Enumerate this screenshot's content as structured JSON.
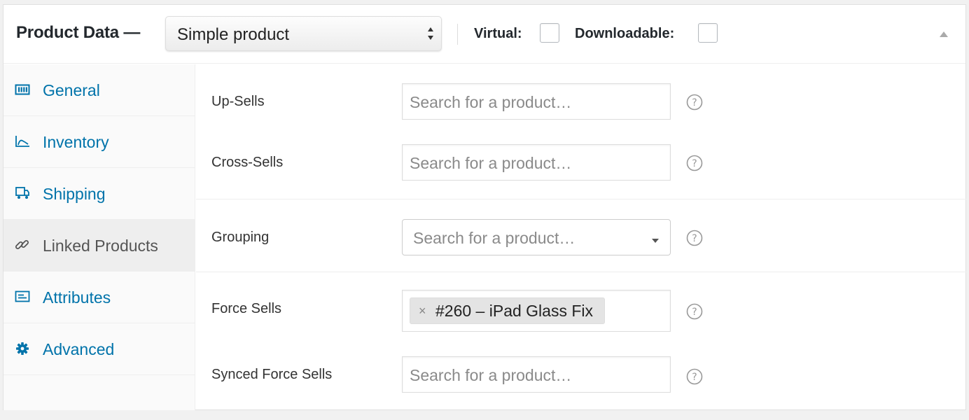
{
  "header": {
    "title": "Product Data —",
    "product_type": "Simple product",
    "virtual_label": "Virtual:",
    "downloadable_label": "Downloadable:",
    "virtual_checked": false,
    "downloadable_checked": false
  },
  "colors": {
    "link": "#0073aa",
    "active_tab_bg": "#eeeeee",
    "sidebar_bg": "#fafafa"
  },
  "tabs": [
    {
      "label": "General",
      "icon": "general-icon",
      "active": false
    },
    {
      "label": "Inventory",
      "icon": "inventory-icon",
      "active": false
    },
    {
      "label": "Shipping",
      "icon": "shipping-icon",
      "active": false
    },
    {
      "label": "Linked Products",
      "icon": "link-icon",
      "active": true
    },
    {
      "label": "Attributes",
      "icon": "attributes-icon",
      "active": false
    },
    {
      "label": "Advanced",
      "icon": "gear-icon",
      "active": false
    }
  ],
  "fields": {
    "upsells": {
      "label": "Up-Sells",
      "placeholder": "Search for a product…"
    },
    "crosssells": {
      "label": "Cross-Sells",
      "placeholder": "Search for a product…"
    },
    "grouping": {
      "label": "Grouping",
      "placeholder": "Search for a product…"
    },
    "forcesells": {
      "label": "Force Sells",
      "token": "#260 – iPad Glass Fix",
      "remove": "×"
    },
    "syncedforcesells": {
      "label": "Synced Force Sells",
      "placeholder": "Search for a product…"
    }
  }
}
